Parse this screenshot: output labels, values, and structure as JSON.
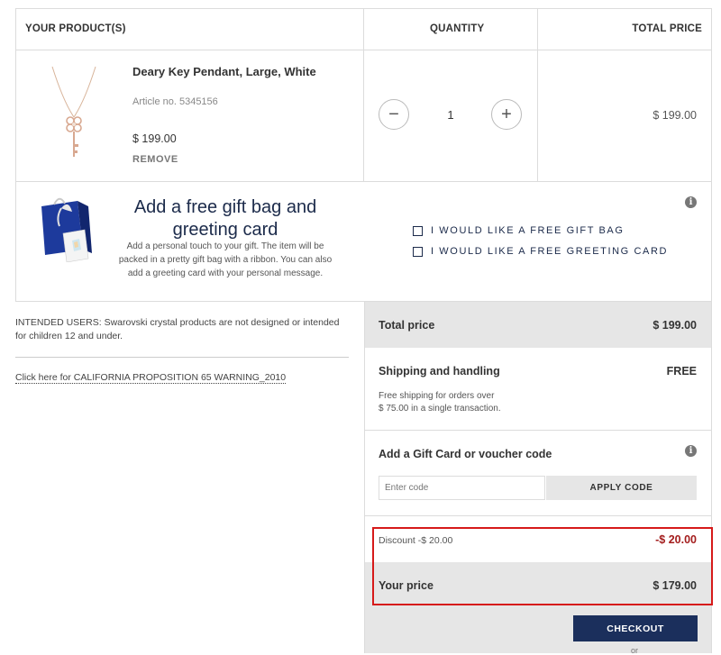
{
  "cart": {
    "headers": {
      "products": "YOUR PRODUCT(S)",
      "quantity": "QUANTITY",
      "total": "TOTAL PRICE"
    },
    "item": {
      "name": "Deary Key Pendant, Large, White",
      "article": "Article no. 5345156",
      "price": "$ 199.00",
      "remove": "REMOVE",
      "quantity": "1",
      "total": "$ 199.00",
      "image_icon": "key-pendant-image"
    },
    "quantity_controls": {
      "decrease": "−",
      "increase": "+"
    }
  },
  "gift": {
    "title": "Add a free gift bag and greeting card",
    "description": "Add a personal touch to your gift. The item will be packed in a pretty gift bag with a ribbon. You can also add a greeting card with your personal message.",
    "options": [
      {
        "label": "I WOULD LIKE A FREE GIFT BAG",
        "checked": false
      },
      {
        "label": "I WOULD LIKE A FREE GREETING CARD",
        "checked": false
      }
    ],
    "info": "i",
    "image_icon": "gift-bag-image"
  },
  "notes": {
    "intended_users": "INTENDED USERS: Swarovski crystal products are not designed or intended for children 12 and under.",
    "prop65_link": "Click here for CALIFORNIA PROPOSITION 65 WARNING_2010"
  },
  "summary": {
    "total_label": "Total price",
    "total_value": "$ 199.00",
    "shipping_label": "Shipping and handling",
    "shipping_value": "FREE",
    "shipping_note_1": "Free shipping for orders over",
    "shipping_note_2": "$ 75.00 in a single transaction.",
    "voucher_label": "Add a Gift Card or voucher code",
    "voucher_info": "i",
    "code_placeholder": "Enter code",
    "apply_label": "APPLY CODE",
    "discount_label": "Discount   -$ 20.00",
    "discount_value": "-$ 20.00",
    "your_price_label": "Your price",
    "your_price_value": "$ 179.00",
    "checkout_label": "CHECKOUT",
    "or_label": "or"
  },
  "colors": {
    "navy": "#1b2f5c",
    "discount_red": "#a31d1d",
    "highlight_border": "#d61a1a",
    "grey_band": "#e6e6e6"
  }
}
